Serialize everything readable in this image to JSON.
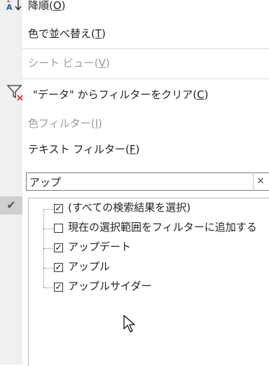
{
  "menu": {
    "sort_desc": {
      "label": "降順(",
      "key": "O",
      "suffix": ")"
    },
    "sort_by_color": {
      "label": "色で並べ替え(",
      "key": "T",
      "suffix": ")"
    },
    "sheet_view": {
      "label": "シート ビュー(",
      "key": "V",
      "suffix": ")"
    },
    "clear_filter": {
      "label": "\"データ\" からフィルターをクリア(",
      "key": "C",
      "suffix": ")"
    },
    "color_filter": {
      "label": "色フィルター(",
      "key": "I",
      "suffix": ")"
    },
    "text_filter": {
      "label": "テキスト フィルター(",
      "key": "F",
      "suffix": ")"
    }
  },
  "search": {
    "value": "アップ",
    "clear_glyph": "×"
  },
  "list": {
    "items": [
      {
        "label": "(すべての検索結果を選択)",
        "checked": true
      },
      {
        "label": "現在の選択範囲をフィルターに追加する",
        "checked": false
      },
      {
        "label": "アップデート",
        "checked": true
      },
      {
        "label": "アップル",
        "checked": true
      },
      {
        "label": "アップルサイダー",
        "checked": true
      }
    ]
  },
  "icons": {
    "sort_desc": "sort-descending-icon",
    "clear_filter": "clear-filter-icon",
    "selected_check": "check-icon",
    "cursor": "mouse-cursor-icon"
  }
}
